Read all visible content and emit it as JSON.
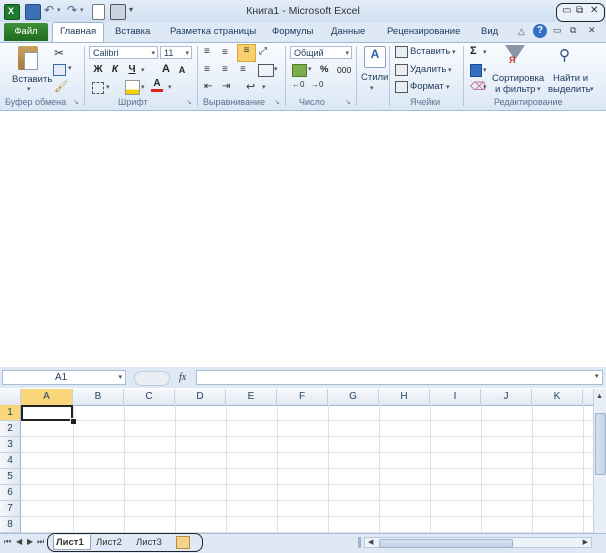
{
  "window_title": "Книга1  -  Microsoft Excel",
  "tabs": {
    "file": "Файл",
    "home": "Главная",
    "insert": "Вставка",
    "page_layout": "Разметка страницы",
    "formulas": "Формулы",
    "data": "Данные",
    "review": "Рецензирование",
    "view": "Вид"
  },
  "ribbon": {
    "clipboard": {
      "label": "Буфер обмена",
      "paste": "Вставить"
    },
    "font": {
      "label": "Шрифт",
      "name": "Calibri",
      "size": "11",
      "bold": "Ж",
      "italic": "К",
      "underline": "Ч",
      "grow": "A",
      "shrink": "A",
      "color_letter": "A"
    },
    "alignment": {
      "label": "Выравнивание"
    },
    "number": {
      "label": "Число",
      "format": "Общий",
      "percent": "%",
      "thousands": "000"
    },
    "styles": {
      "label": "Стили"
    },
    "cells": {
      "label": "Ячейки",
      "insert": "Вставить",
      "delete": "Удалить",
      "format": "Формат"
    },
    "editing": {
      "label": "Редактирование",
      "sort_line1": "Сортировка",
      "sort_line2": "и фильтр",
      "find_line1": "Найти и",
      "find_line2": "выделить"
    }
  },
  "formula_bar": {
    "name_box": "A1",
    "fx": "fx",
    "formula": ""
  },
  "columns": [
    "A",
    "B",
    "C",
    "D",
    "E",
    "F",
    "G",
    "H",
    "I",
    "J",
    "K"
  ],
  "rows": [
    "1",
    "2",
    "3",
    "4",
    "5",
    "6",
    "7",
    "8"
  ],
  "sheets": [
    "Лист1",
    "Лист2",
    "Лист3"
  ],
  "colors": {
    "file_tab": "#2a7a26",
    "ribbon_bg": "#dfe9f5",
    "accent": "#1e395b",
    "highlight": "#f9cf6b"
  }
}
